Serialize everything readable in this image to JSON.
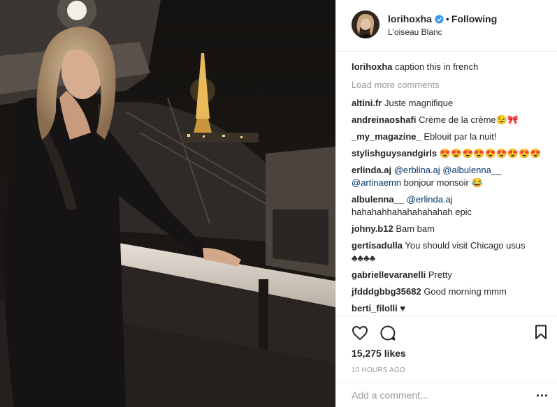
{
  "header": {
    "username": "lorihoxha",
    "separator": "•",
    "follow_status": "Following",
    "location": "L'oiseau Blanc",
    "verified_color": "#3897f0"
  },
  "caption": {
    "username": "lorihoxha",
    "text": "caption this in french"
  },
  "load_more": "Load more comments",
  "comments": [
    {
      "username": "altini.fr",
      "text": "Juste magnifique"
    },
    {
      "username": "andreinaoshafi",
      "text": "Crème de la crème😉🎀"
    },
    {
      "username": "_my_magazine_",
      "text": "Eblouit par la nuit!"
    },
    {
      "username": "stylishguysandgirls",
      "text": "😍😍😍😍😍😍😍😍😍"
    },
    {
      "username": "erlinda.aj",
      "mention1": "@erblina.aj",
      "mention2": "@albulenna__",
      "mention3": "@artinaemn",
      "text": "bonjour monsoir 😂"
    },
    {
      "username": "albulenna__",
      "mention1": "@erlinda.aj",
      "text": "hahahahhahahahahahah epic"
    },
    {
      "username": "johny.b12",
      "text": "Bam bam"
    },
    {
      "username": "gertisadulla",
      "text": "You should visit Chicago usus ♣♣♣♣"
    },
    {
      "username": "gabriellevaranelli",
      "text": "Pretty"
    },
    {
      "username": "jfdddgbbg35682",
      "text": "Good morning mmm"
    },
    {
      "username": "berti_filolli",
      "text": "♥"
    }
  ],
  "actions": {
    "likes": "15,275 likes",
    "timestamp": "10 HOURS AGO"
  },
  "comment_box": {
    "placeholder": "Add a comment..."
  },
  "icons": {
    "like": "heart-outline-icon",
    "comment": "speech-bubble-icon",
    "save": "bookmark-icon",
    "more": "more-options-icon"
  }
}
